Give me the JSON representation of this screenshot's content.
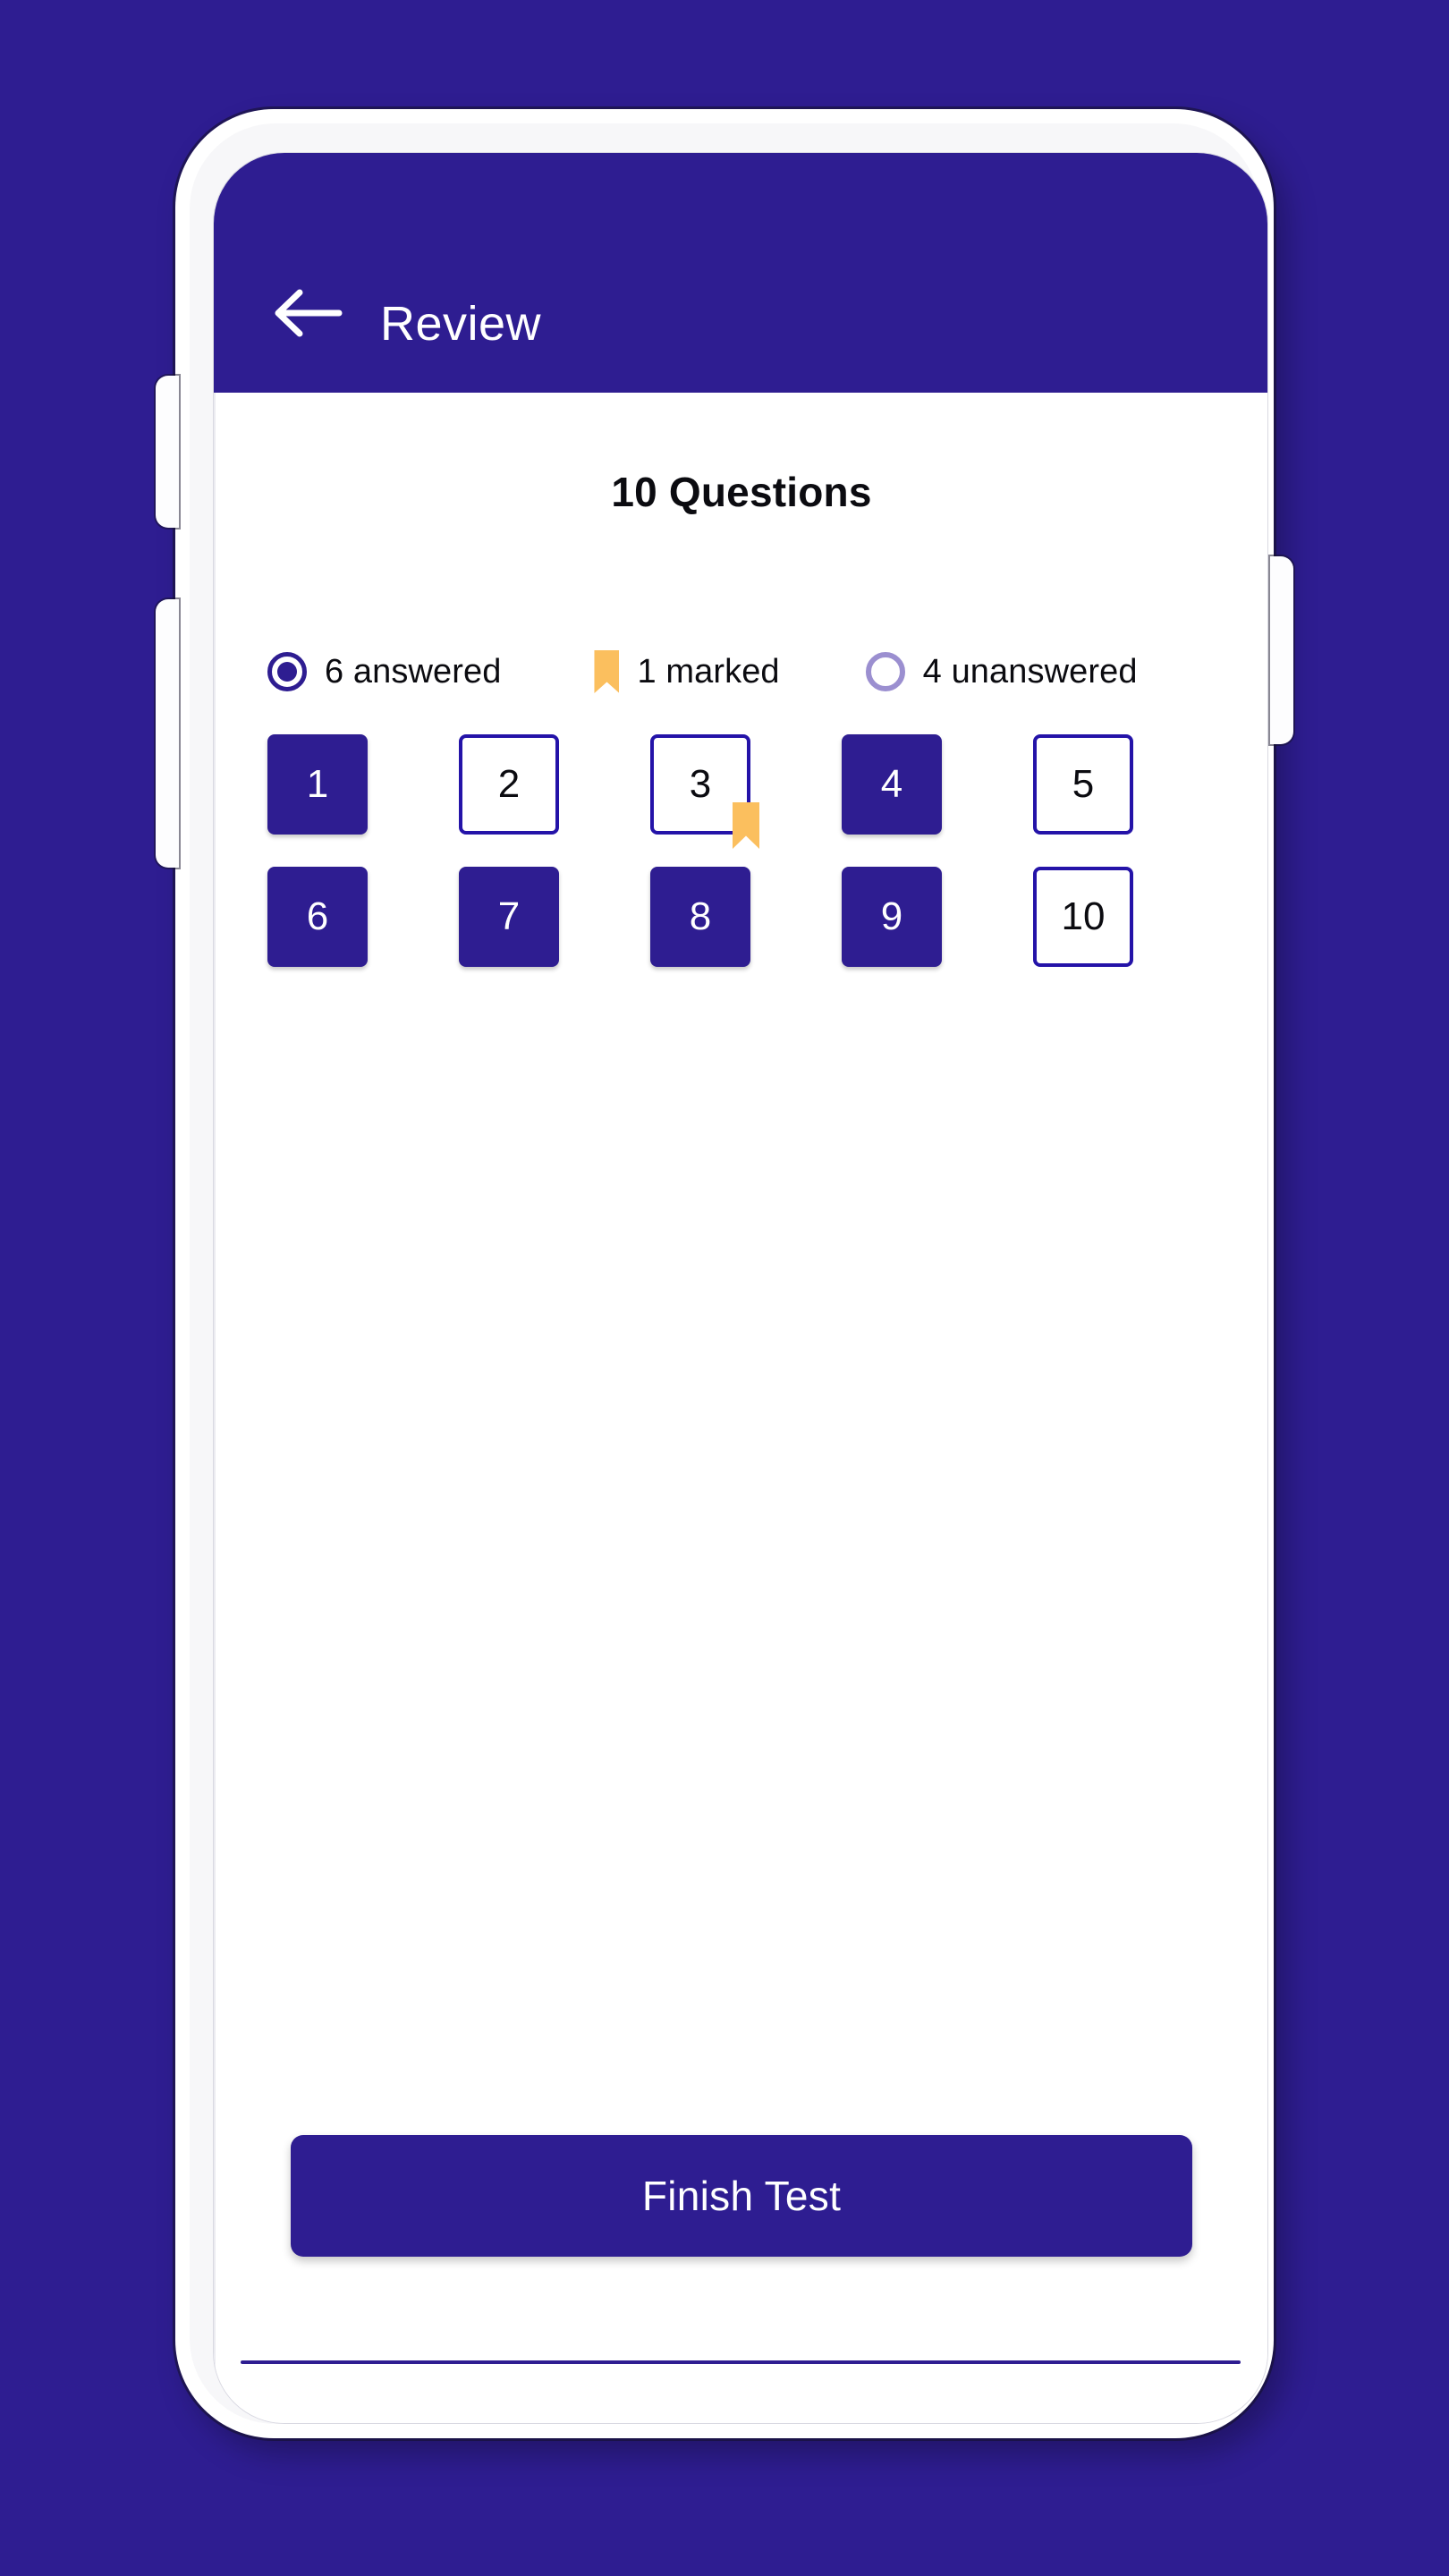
{
  "theme": {
    "brand_purple": "#2E1D91",
    "tile_border": "#2413A8",
    "marker_orange": "#FBBF5E",
    "unanswered_ring": "#9B8FD0",
    "screen_white": "#FFFFFF",
    "text_dark": "#0B0B10"
  },
  "appbar": {
    "back_icon": "arrow-left-icon",
    "title": "Review"
  },
  "main": {
    "question_count_title": "10 Questions",
    "legend": [
      {
        "key": "answered",
        "icon": "radio-filled-icon",
        "label": "6 answered",
        "count": 6
      },
      {
        "key": "marked",
        "icon": "bookmark-icon",
        "label": "1 marked",
        "count": 1
      },
      {
        "key": "unanswered",
        "icon": "circle-outline-icon",
        "label": "4 unanswered",
        "count": 4
      }
    ],
    "questions": [
      {
        "number": "1",
        "state": "answered",
        "marked": false
      },
      {
        "number": "2",
        "state": "unanswered",
        "marked": false
      },
      {
        "number": "3",
        "state": "unanswered",
        "marked": true
      },
      {
        "number": "4",
        "state": "answered",
        "marked": false
      },
      {
        "number": "5",
        "state": "unanswered",
        "marked": false
      },
      {
        "number": "6",
        "state": "answered",
        "marked": false
      },
      {
        "number": "7",
        "state": "answered",
        "marked": false
      },
      {
        "number": "8",
        "state": "answered",
        "marked": false
      },
      {
        "number": "9",
        "state": "answered",
        "marked": false
      },
      {
        "number": "10",
        "state": "unanswered",
        "marked": false
      }
    ]
  },
  "footer": {
    "finish_label": "Finish Test"
  },
  "device": {
    "buttons": [
      "volume-up-button",
      "volume-down-button",
      "power-button"
    ]
  }
}
